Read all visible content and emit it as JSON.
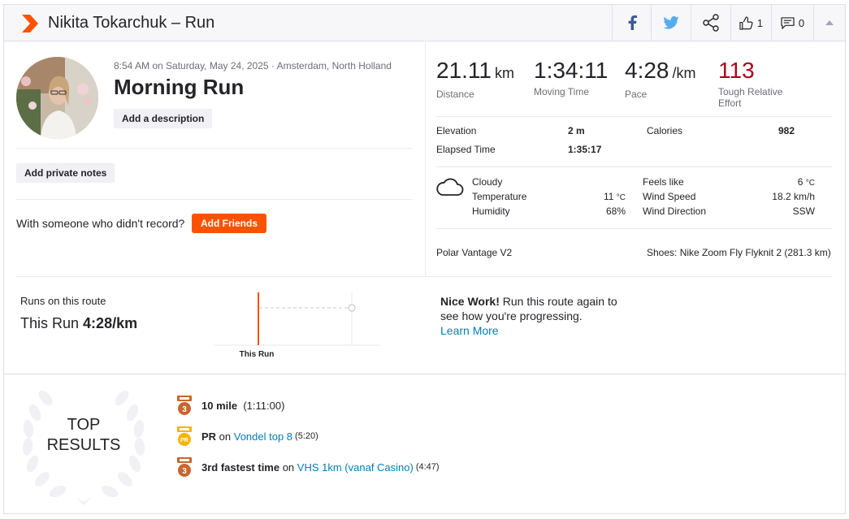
{
  "header": {
    "title": "Nikita Tokarchuk – Run",
    "kudos_count": "1",
    "comment_count": "0"
  },
  "summary": {
    "meta": "8:54 AM on Saturday, May 24, 2025 · Amsterdam, North Holland",
    "activity_title": "Morning Run",
    "add_description": "Add a description",
    "add_private_notes": "Add private notes",
    "with_someone": "With someone who didn't record?",
    "add_friends": "Add Friends"
  },
  "stats": {
    "distance_value": "21.11",
    "distance_unit": "km",
    "distance_label": "Distance",
    "moving_time_value": "1:34:11",
    "moving_time_label": "Moving Time",
    "pace_value": "4:28",
    "pace_unit": "/km",
    "pace_label": "Pace",
    "effort_value": "113",
    "effort_label": "Tough Relative Effort"
  },
  "more_stats": {
    "elevation_label": "Elevation",
    "elevation_value": "2 m",
    "calories_label": "Calories",
    "calories_value": "982",
    "elapsed_label": "Elapsed Time",
    "elapsed_value": "1:35:17"
  },
  "weather": {
    "condition": "Cloudy",
    "temperature_label": "Temperature",
    "temperature_value": "11",
    "humidity_label": "Humidity",
    "humidity_value": "68%",
    "feels_like_label": "Feels like",
    "feels_like_value": "6",
    "wind_speed_label": "Wind Speed",
    "wind_speed_value": "18.2 km/h",
    "wind_direction_label": "Wind Direction",
    "wind_direction_value": "SSW",
    "degree_unit": "°C"
  },
  "gear": {
    "device": "Polar Vantage V2",
    "shoes": "Shoes: Nike Zoom Fly Flyknit 2 (281.3 km)"
  },
  "route": {
    "label": "Runs on this route",
    "this_run_prefix": "This Run",
    "this_run_pace": "4:28/km",
    "chart_caption": "This Run",
    "nice_work_bold": "Nice Work!",
    "nice_work_text": " Run this route again to see how you're progressing.",
    "learn_more": "Learn More"
  },
  "top_results": {
    "title_line1": "TOP",
    "title_line2": "RESULTS",
    "items": [
      {
        "medal": "3",
        "bold": "10 mile",
        "text": "",
        "link": "",
        "time": "(1:11:00)"
      },
      {
        "medal": "PR",
        "bold": "PR",
        "text": " on ",
        "link": "Vondel top 8",
        "time": "(5:20)"
      },
      {
        "medal": "3",
        "bold": "3rd fastest time",
        "text": " on ",
        "link": "VHS 1km (vanaf Casino)",
        "time": "(4:47)"
      }
    ]
  },
  "colors": {
    "brand": "#fc5200",
    "effort": "#a8071a",
    "link": "#007fb6",
    "bronze": "#c8662d",
    "gold": "#f5b400"
  },
  "icons": [
    "strava-logo-icon",
    "facebook-icon",
    "twitter-icon",
    "share-icon",
    "thumbs-up-icon",
    "comment-icon",
    "caret-up-icon",
    "cloud-icon",
    "medal-icon",
    "laurel-wreath-icon"
  ]
}
